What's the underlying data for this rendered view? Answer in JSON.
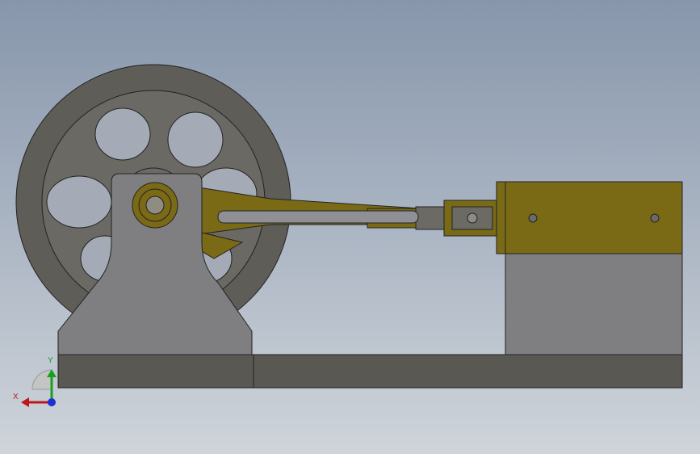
{
  "viewport": {
    "background_top": "#8796ab",
    "background_bottom": "#cfd4da"
  },
  "model": {
    "colors": {
      "flywheel": "#5e5d58",
      "pedestal": "#7f7f82",
      "base": "#5a5853",
      "brass": "#7a6a16",
      "cylinder_block": "#7f7f82",
      "rod": "#8f9096"
    }
  },
  "triad": {
    "x_label": "X",
    "y_label": "Y",
    "x_color": "#c0151b",
    "y_color": "#17a11d",
    "z_color": "#1a2fd8"
  }
}
